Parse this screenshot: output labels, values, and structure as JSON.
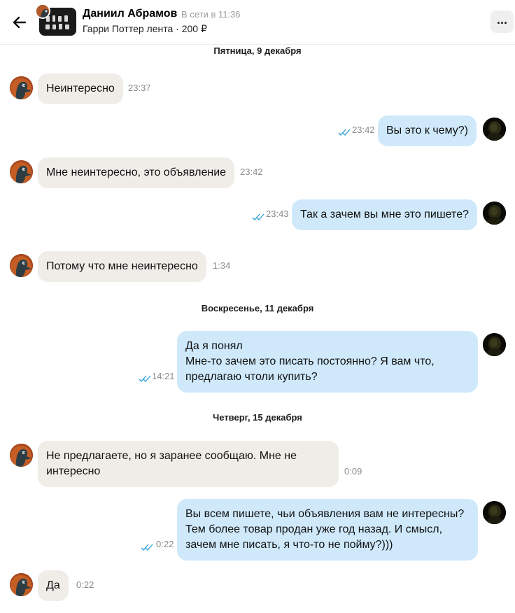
{
  "header": {
    "contact_name": "Даниил Абрамов",
    "status": "В сети в 11:36",
    "listing": "Гарри Поттер лента · 200 ₽",
    "back_icon": "arrow-left-icon",
    "more_icon": "ellipsis-icon"
  },
  "dates": {
    "d1": "Пятница, 9 декабря",
    "d2": "Воскресенье, 11 декабря",
    "d3": "Четверг, 15 декабря"
  },
  "messages": [
    {
      "dir": "in",
      "text": "Неинтересно",
      "time": "23:37"
    },
    {
      "dir": "out",
      "text": "Вы это к чему?)",
      "time": "23:42",
      "read": true
    },
    {
      "dir": "in",
      "text": "Мне неинтересно, это объявление",
      "time": "23:42"
    },
    {
      "dir": "out",
      "text": "Так а зачем вы мне это пишете?",
      "time": "23:43",
      "read": true
    },
    {
      "dir": "in",
      "text": "Потому что мне неинтересно",
      "time": "1:34"
    },
    {
      "dir": "out",
      "text": "Да я понял\nМне-то зачем это писать постоянно? Я вам что,\nпредлагаю чтоли купить?",
      "time": "14:21",
      "read": true
    },
    {
      "dir": "in",
      "text": "Не предлагаете, но я заранее сообщаю. Мне не\nинтересно",
      "time": "0:09"
    },
    {
      "dir": "out",
      "text": "Вы всем пишете, чьи объявления вам не интересны?\nТем более товар продан уже год назад. И смысл,\nзачем мне писать, я что-то не пойму?)))",
      "time": "0:22",
      "read": true
    },
    {
      "dir": "in",
      "text": "Да",
      "time": "0:22"
    }
  ],
  "colors": {
    "incoming_bubble": "#f0ede8",
    "outgoing_bubble": "#cfe9fb",
    "read_check": "#2a9fd8"
  }
}
